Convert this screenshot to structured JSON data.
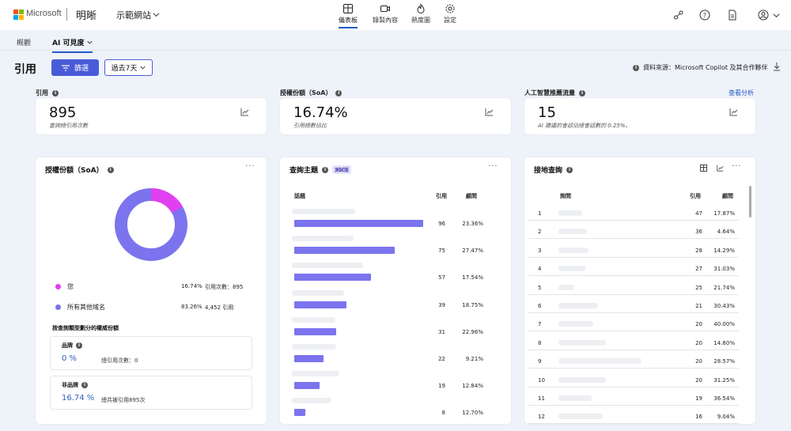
{
  "header": {
    "brand": "Microsoft",
    "app_name": "明晰",
    "site_name": "示範網站",
    "nav": [
      {
        "label": "儀表板",
        "icon": "dashboard-icon"
      },
      {
        "label": "錄製內容",
        "icon": "video-icon"
      },
      {
        "label": "熱度圖",
        "icon": "flame-icon"
      },
      {
        "label": "設定",
        "icon": "gear-icon"
      }
    ],
    "right_icons": [
      "share-icon",
      "help-icon",
      "document-icon",
      "account-icon"
    ]
  },
  "colors": {
    "accent": "#4a5bd8",
    "bar": "#7b74ee",
    "you": "#e040f0",
    "others": "#7b74ee",
    "link": "#2458c6"
  },
  "subtabs": [
    "概觀",
    "AI 可見度"
  ],
  "toolbar": {
    "title": "引用",
    "filter_label": "篩選",
    "range_label": "過去7天",
    "source_text": "資料來源：Microsoft Copilot 及其合作夥伴"
  },
  "kpis": [
    {
      "label": "引用",
      "value": "895",
      "sub": "查詢總引用次數"
    },
    {
      "label": "授權份額（SoA）",
      "value": "16.74%",
      "sub": "引用總數佔比"
    },
    {
      "label": "人工智慧推薦流量",
      "value": "15",
      "sub": "AI 建議的會話佔總會話數的 0.25%。",
      "link": "查看分析"
    }
  ],
  "soa": {
    "title": "授權份額（SoA）",
    "legend": [
      {
        "name": "您",
        "pct": "16.74%",
        "detail": "引用次數：895"
      },
      {
        "name": "所有其他域名",
        "pct": "83.26%",
        "detail": "4,452 引用"
      }
    ],
    "section": "按查詢類型劃分的權威份額",
    "brand": {
      "title": "品牌",
      "pct": "0 %",
      "note": "總引用次數：0"
    },
    "nonbrand": {
      "title": "非品牌",
      "pct": "16.74 %",
      "note": "總共被引用895次"
    }
  },
  "topics": {
    "title": "查詢主題",
    "badge": "測試版",
    "headers": {
      "topic": "話題",
      "citations": "引用",
      "ratio": "顧問"
    },
    "rows": [
      {
        "citations": 96,
        "ratio": "23.36%"
      },
      {
        "citations": 75,
        "ratio": "27.47%"
      },
      {
        "citations": 57,
        "ratio": "17.54%"
      },
      {
        "citations": 39,
        "ratio": "18.75%"
      },
      {
        "citations": 31,
        "ratio": "22.96%"
      },
      {
        "citations": 22,
        "ratio": "9.21%"
      },
      {
        "citations": 19,
        "ratio": "12.84%"
      },
      {
        "citations": 8,
        "ratio": "12.70%"
      }
    ]
  },
  "queries": {
    "title": "接地查詢",
    "headers": {
      "query": "詢問",
      "citations": "引用",
      "ratio": "顧問"
    },
    "rows": [
      {
        "n": "1",
        "citations": "47",
        "ratio": "17.87%"
      },
      {
        "n": "2",
        "citations": "36",
        "ratio": "4.64%"
      },
      {
        "n": "3",
        "citations": "28",
        "ratio": "14.29%"
      },
      {
        "n": "4",
        "citations": "27",
        "ratio": "31.03%"
      },
      {
        "n": "5",
        "citations": "25",
        "ratio": "21.74%"
      },
      {
        "n": "6",
        "citations": "21",
        "ratio": "30.43%"
      },
      {
        "n": "7",
        "citations": "20",
        "ratio": "40.00%"
      },
      {
        "n": "8",
        "citations": "20",
        "ratio": "14.60%"
      },
      {
        "n": "9",
        "citations": "20",
        "ratio": "28.57%"
      },
      {
        "n": "10",
        "citations": "20",
        "ratio": "31.25%"
      },
      {
        "n": "11",
        "citations": "19",
        "ratio": "36.54%"
      },
      {
        "n": "12",
        "citations": "16",
        "ratio": "9.04%"
      }
    ]
  }
}
